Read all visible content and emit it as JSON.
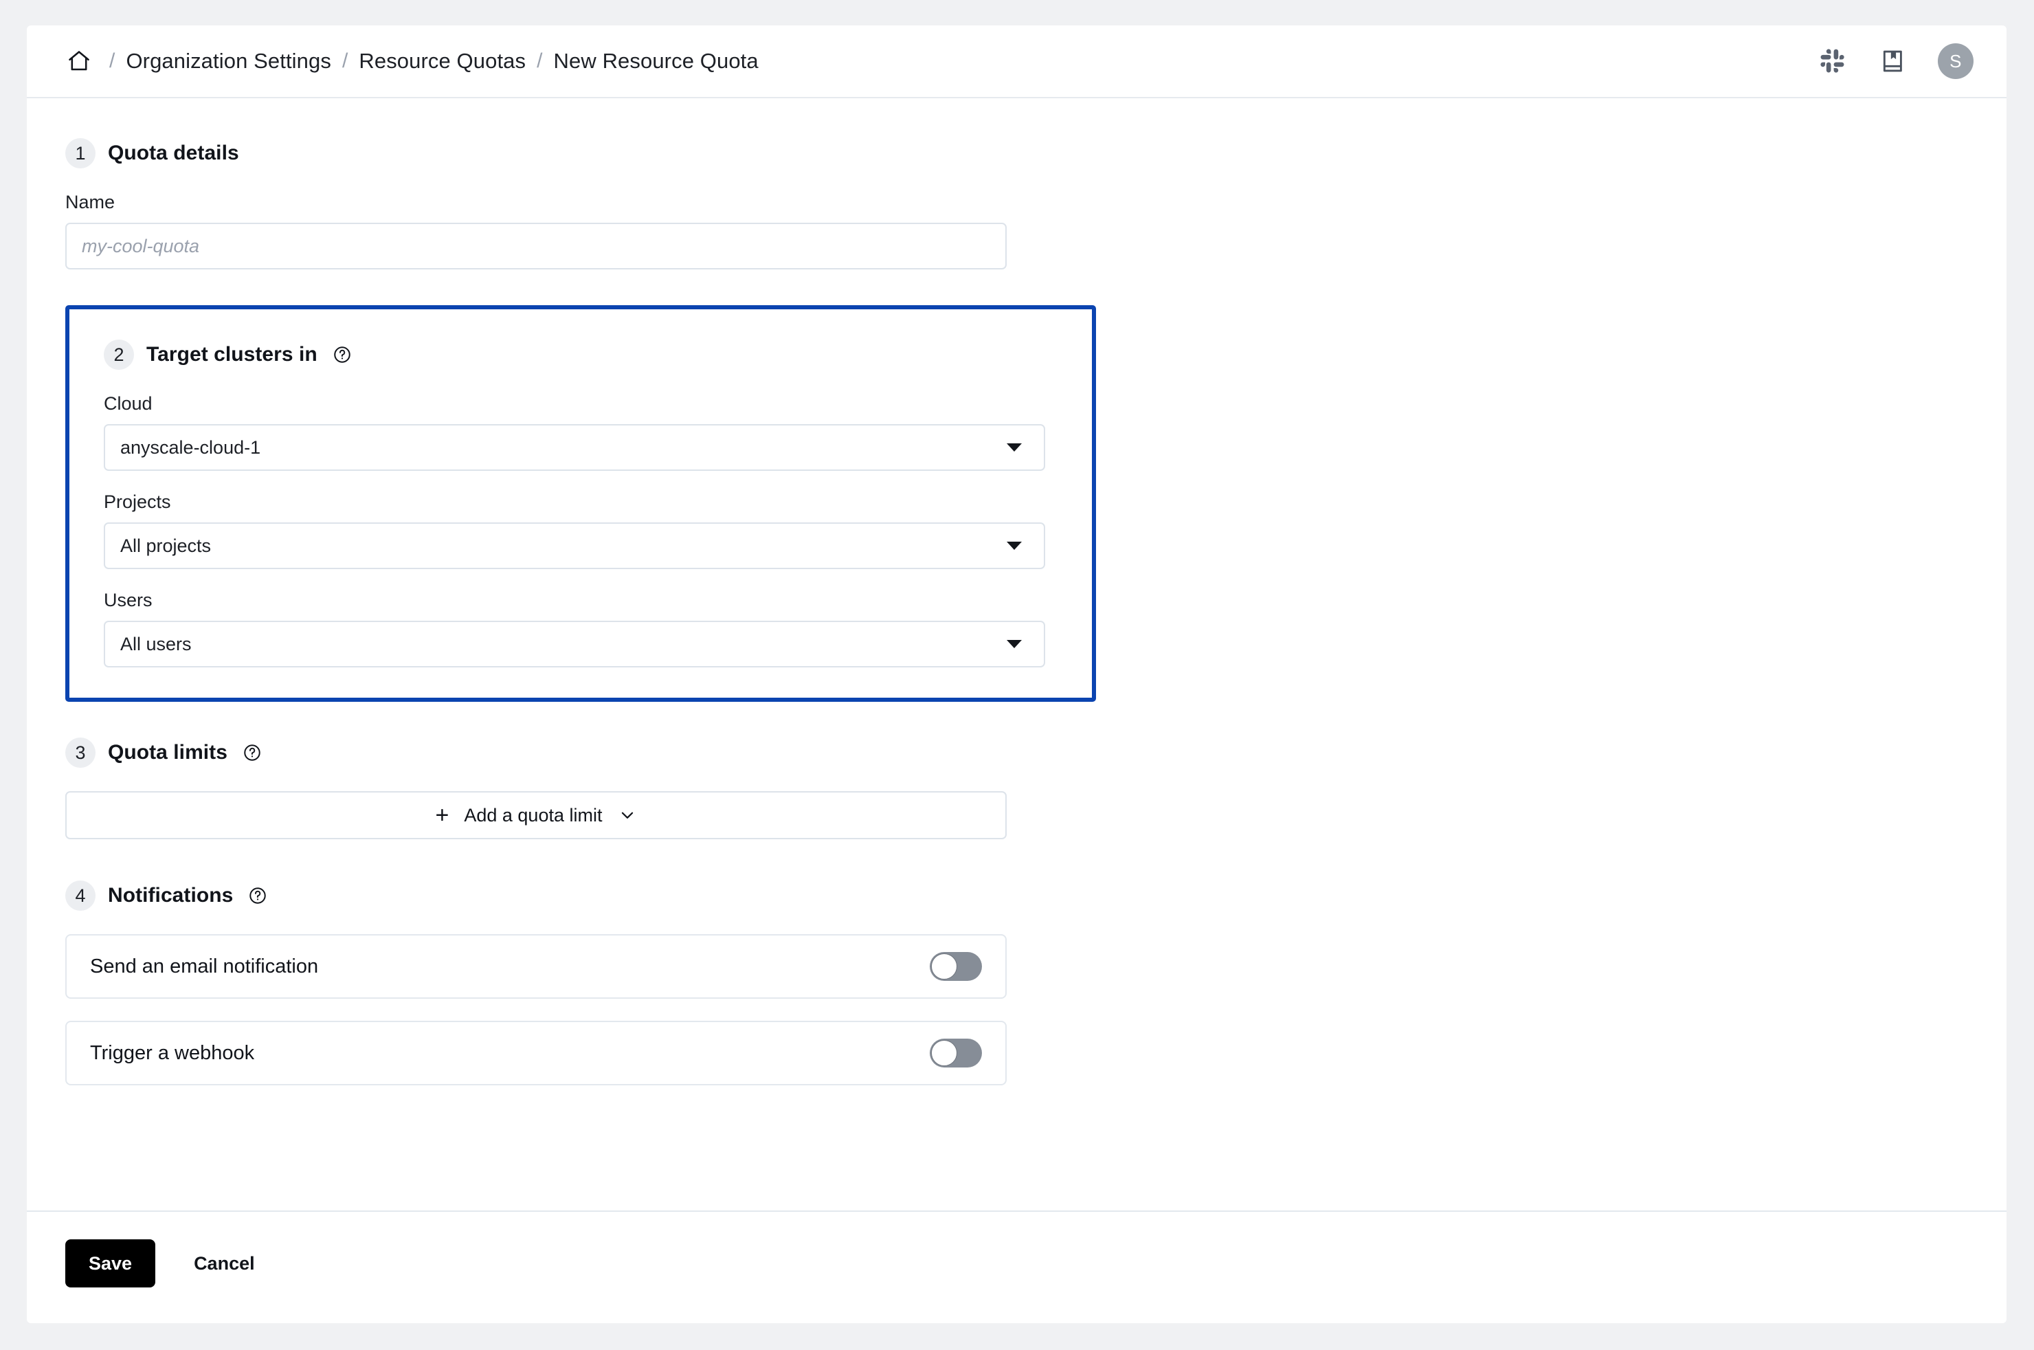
{
  "header": {
    "home_icon": "home-icon",
    "breadcrumb": [
      {
        "label": "Organization Settings"
      },
      {
        "label": "Resource Quotas"
      },
      {
        "label": "New Resource Quota"
      }
    ],
    "separator": "/",
    "actions": [
      {
        "icon": "slack-icon"
      },
      {
        "icon": "book-icon"
      }
    ],
    "avatar_initial": "S"
  },
  "sections": {
    "quota_details": {
      "number": "1",
      "title": "Quota details",
      "name_label": "Name",
      "name_value": "",
      "name_placeholder": "my-cool-quota"
    },
    "target_clusters": {
      "number": "2",
      "title": "Target clusters in",
      "help_icon": "help-circle-icon",
      "highlighted": true,
      "highlight_color": "#0b44b0",
      "cloud_label": "Cloud",
      "cloud_value": "anyscale-cloud-1",
      "projects_label": "Projects",
      "projects_value": "All projects",
      "users_label": "Users",
      "users_value": "All users"
    },
    "quota_limits": {
      "number": "3",
      "title": "Quota limits",
      "help_icon": "help-circle-icon",
      "add_label": "Add a quota limit",
      "add_plus": "+",
      "add_caret": "chevron-down-icon"
    },
    "notifications": {
      "number": "4",
      "title": "Notifications",
      "help_icon": "help-circle-icon",
      "rows": [
        {
          "label": "Send an email notification",
          "enabled": false
        },
        {
          "label": "Trigger a webhook",
          "enabled": false
        }
      ]
    }
  },
  "footer": {
    "save_label": "Save",
    "cancel_label": "Cancel"
  },
  "colors": {
    "accent_blue": "#0b44b0",
    "page_bg": "#f0f1f3",
    "card_bg": "#ffffff",
    "border": "#dde3ea",
    "text": "#11141a",
    "muted": "#9aa1ad",
    "toggle_off": "#868d97",
    "avatar_bg": "#9ca3ab",
    "primary_btn": "#000000"
  }
}
